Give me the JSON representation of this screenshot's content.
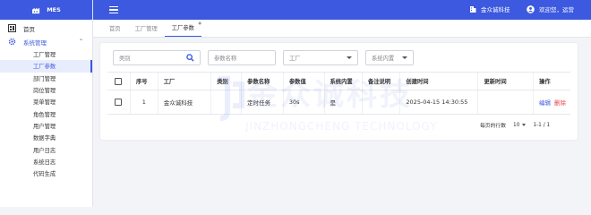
{
  "app": {
    "name": "MES"
  },
  "header": {
    "company": "金众诚科技",
    "greeting": "欢迎您，运营"
  },
  "sidebar": {
    "home": "首页",
    "group": "系统管理",
    "items": [
      {
        "label": "工厂管理",
        "active": false
      },
      {
        "label": "工厂参数",
        "active": true
      },
      {
        "label": "部门管理",
        "active": false
      },
      {
        "label": "岗位管理",
        "active": false
      },
      {
        "label": "菜单管理",
        "active": false
      },
      {
        "label": "角色管理",
        "active": false
      },
      {
        "label": "用户管理",
        "active": false
      },
      {
        "label": "数据字典",
        "active": false
      },
      {
        "label": "用户日志",
        "active": false
      },
      {
        "label": "系统日志",
        "active": false
      },
      {
        "label": "代码生成",
        "active": false
      }
    ]
  },
  "tabs": [
    {
      "label": "首页",
      "active": false
    },
    {
      "label": "工厂管理",
      "active": false
    },
    {
      "label": "工厂参数",
      "active": true
    }
  ],
  "filters": {
    "category_placeholder": "类别",
    "param_name_placeholder": "参数名称",
    "factory_placeholder": "工厂",
    "builtin_placeholder": "系统内置"
  },
  "table": {
    "headers": [
      "序号",
      "工厂",
      "类别",
      "参数名称",
      "参数值",
      "系统内置",
      "备注说明",
      "创建时间",
      "更新时间",
      "操作"
    ],
    "rows": [
      {
        "index": "1",
        "factory": "金众诚科技",
        "category": "",
        "param_name": "定时任务",
        "param_value": "30s",
        "builtin": "是",
        "remark": "",
        "created": "2025-04-15 14:30:55",
        "updated": "",
        "edit": "编辑",
        "delete": "删除"
      }
    ]
  },
  "pager": {
    "rows_per_page_label": "每页的行数",
    "page_size": "10",
    "range": "1-1 / 1"
  },
  "watermark": {
    "cn": "金众诚科技",
    "en": "JINZHONGCHENG TECHNOLOGY"
  },
  "colors": {
    "primary": "#3c59df",
    "danger": "#e64545"
  }
}
